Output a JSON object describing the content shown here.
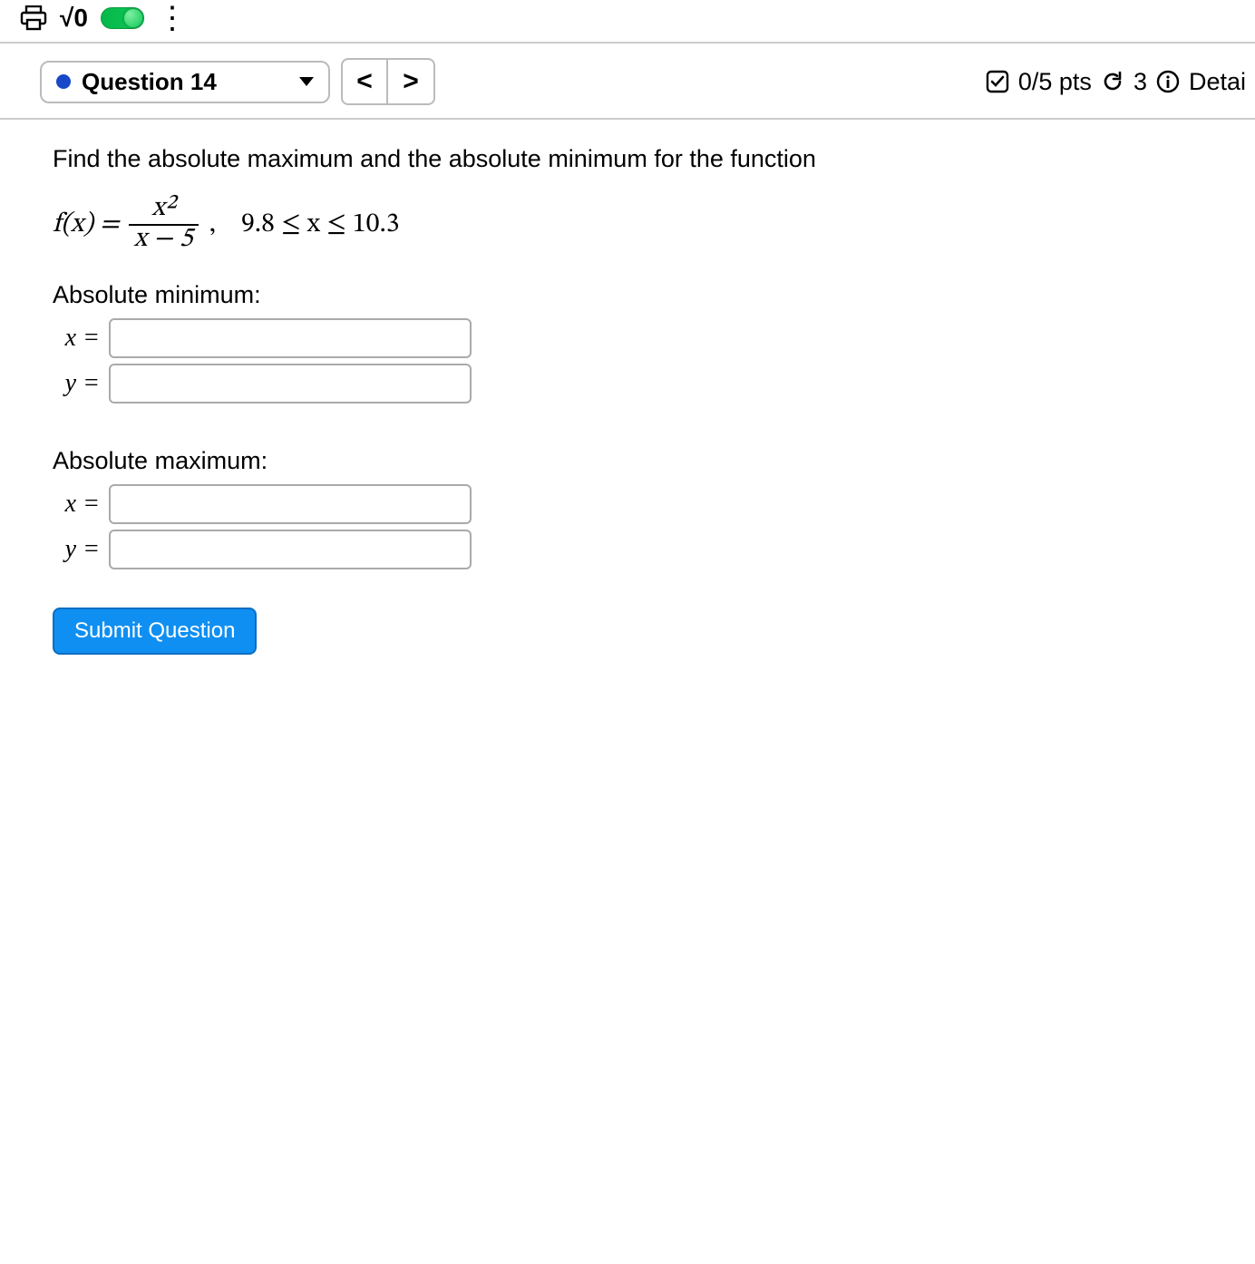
{
  "toolbar": {
    "sqrt_label": "√0",
    "menu_label": "⋮"
  },
  "header": {
    "question_label": "Question 14",
    "prev": "<",
    "next": ">",
    "score": "0/5 pts",
    "attempts": "3",
    "details": "Detai"
  },
  "question": {
    "prompt": "Find the absolute maximum and the absolute minimum for the function",
    "func_lhs": "f(x) =",
    "frac_num": "x²",
    "frac_den": "x − 5",
    "domain_text": "9.8 ≤ x ≤ 10.3",
    "sections": {
      "min_label": "Absolute minimum:",
      "max_label": "Absolute maximum:"
    },
    "labels": {
      "x": "x =",
      "y": "y ="
    },
    "answers": {
      "min_x": "",
      "min_y": "",
      "max_x": "",
      "max_y": ""
    },
    "submit": "Submit Question"
  }
}
